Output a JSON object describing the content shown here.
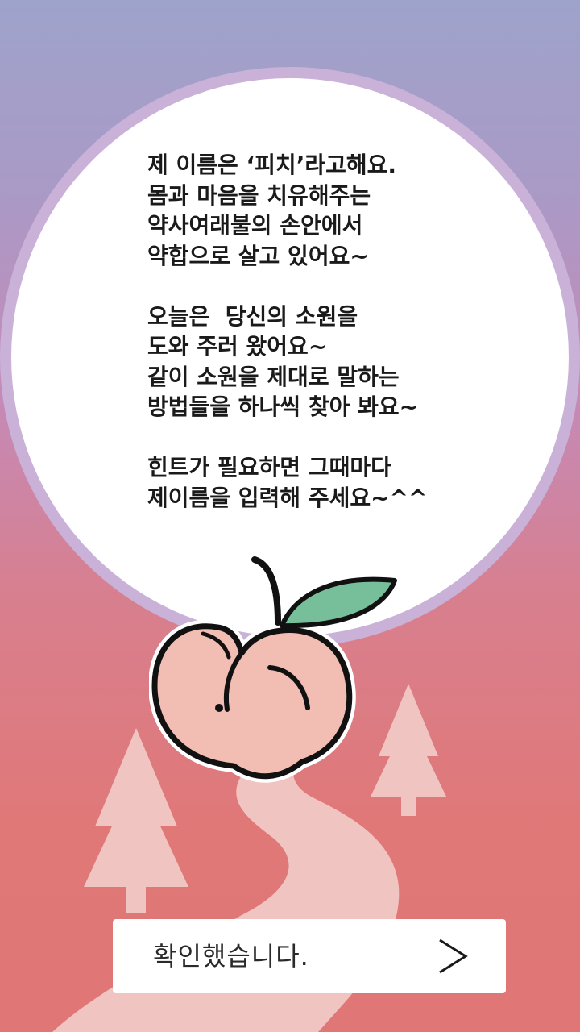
{
  "message": {
    "paragraph1": [
      "제 이름은 ‘피치’라고해요.",
      "몸과 마음을 치유해주는",
      "약사여래불의 손안에서",
      "약합으로 살고 있어요~"
    ],
    "paragraph2": [
      "오늘은  당신의 소원을",
      "도와 주러 왔어요~",
      "같이 소원을 제대로 말하는",
      "방법들을 하나씩 찾아 봐요~"
    ],
    "paragraph3": [
      "힌트가 필요하면 그때마다",
      "제이름을 입력해 주세요~^^"
    ]
  },
  "confirm": {
    "label": "확인했습니다.",
    "icon": "chevron-right-icon"
  },
  "colors": {
    "bubble_border": "#c9b1d8",
    "peach_fill": "#f2bdb3",
    "leaf": "#77bf9b",
    "tree": "#f0c4c0",
    "path": "#f0c4c0"
  }
}
